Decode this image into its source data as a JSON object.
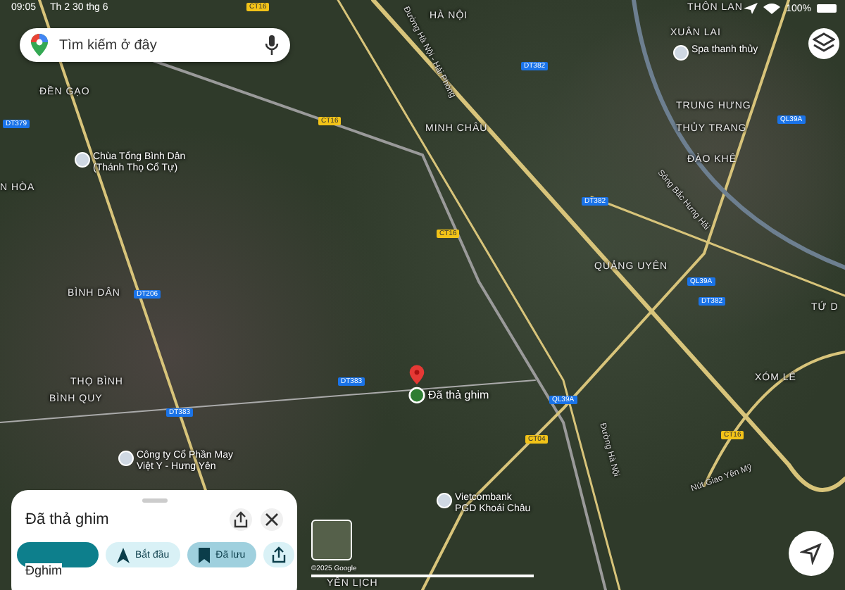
{
  "status_bar": {
    "time": "09:05",
    "date": "Th 2 30 thg 6",
    "battery": "100%"
  },
  "search": {
    "placeholder": "Tìm kiếm ở đây"
  },
  "map_labels": [
    {
      "kind": "place",
      "text": "HÀ NỘI"
    },
    {
      "kind": "place",
      "text": "THÔN LAN"
    },
    {
      "kind": "place",
      "text": "XUÂN LAI"
    },
    {
      "kind": "place",
      "text": "ĐỀN GẠO"
    },
    {
      "kind": "place",
      "text": "N HÒA"
    },
    {
      "kind": "place",
      "text": "MINH CHÂU"
    },
    {
      "kind": "place",
      "text": "BÌNH DÂN"
    },
    {
      "kind": "place",
      "text": "THỌ BÌNH"
    },
    {
      "kind": "place",
      "text": "BÌNH QUY"
    },
    {
      "kind": "place",
      "text": "TRUNG HƯNG"
    },
    {
      "kind": "place",
      "text": "THỦY TRANG"
    },
    {
      "kind": "place",
      "text": "ĐÀO KHÊ"
    },
    {
      "kind": "place",
      "text": "QUẢNG UYÊN"
    },
    {
      "kind": "place",
      "text": "TỨ D"
    },
    {
      "kind": "place",
      "text": "XÓM LÊ"
    },
    {
      "kind": "place",
      "text": "YÊN LỊCH"
    },
    {
      "kind": "poi",
      "text": "Chùa Tổng Bình Dân\n(Thánh Thọ Cổ Tự)"
    },
    {
      "kind": "poi",
      "text": "Spa thanh thủy"
    },
    {
      "kind": "poi",
      "text": "Công ty Cổ Phần May\nViệt Y - Hưng Yên"
    },
    {
      "kind": "poi",
      "text": "Vietcombank\nPGD Khoái Châu"
    },
    {
      "kind": "pin",
      "text": "Đã thả ghim"
    },
    {
      "kind": "road",
      "text": "Đường Hà Nội - Hải Phòng"
    },
    {
      "kind": "road",
      "text": "Sông Bắc Hưng Hải"
    },
    {
      "kind": "road",
      "text": "Đường Hà Nội"
    },
    {
      "kind": "road",
      "text": "Nút Giao Yên Mỹ"
    },
    {
      "kind": "shield",
      "text": "DT379"
    },
    {
      "kind": "shield",
      "text": "DT382"
    },
    {
      "kind": "shield",
      "text": "DT206"
    },
    {
      "kind": "shield",
      "text": "DT383"
    },
    {
      "kind": "shield",
      "text": "DT383"
    },
    {
      "kind": "shield",
      "text": "DT382"
    },
    {
      "kind": "shield",
      "text": "QL39A"
    },
    {
      "kind": "shield",
      "text": "QL39A"
    },
    {
      "kind": "shield",
      "text": "QL39A"
    },
    {
      "kind": "shield",
      "text": "DT382"
    },
    {
      "kind": "highway",
      "text": "CT16"
    },
    {
      "kind": "highway",
      "text": "CT16"
    },
    {
      "kind": "highway",
      "text": "CT16"
    },
    {
      "kind": "highway",
      "text": "CT04"
    },
    {
      "kind": "highway",
      "text": "CT16"
    }
  ],
  "sheet": {
    "title": "Đã thả ghim",
    "overlay_text": "Đghim",
    "actions": [
      {
        "kind": "primary",
        "selected": false
      },
      {
        "kind": "directions",
        "label": "Bắt đầu",
        "selected": false
      },
      {
        "kind": "save",
        "label": "Đã lưu",
        "selected": true
      },
      {
        "kind": "share",
        "selected": false
      }
    ]
  },
  "street_view": {
    "credit": "©2025 Google"
  }
}
